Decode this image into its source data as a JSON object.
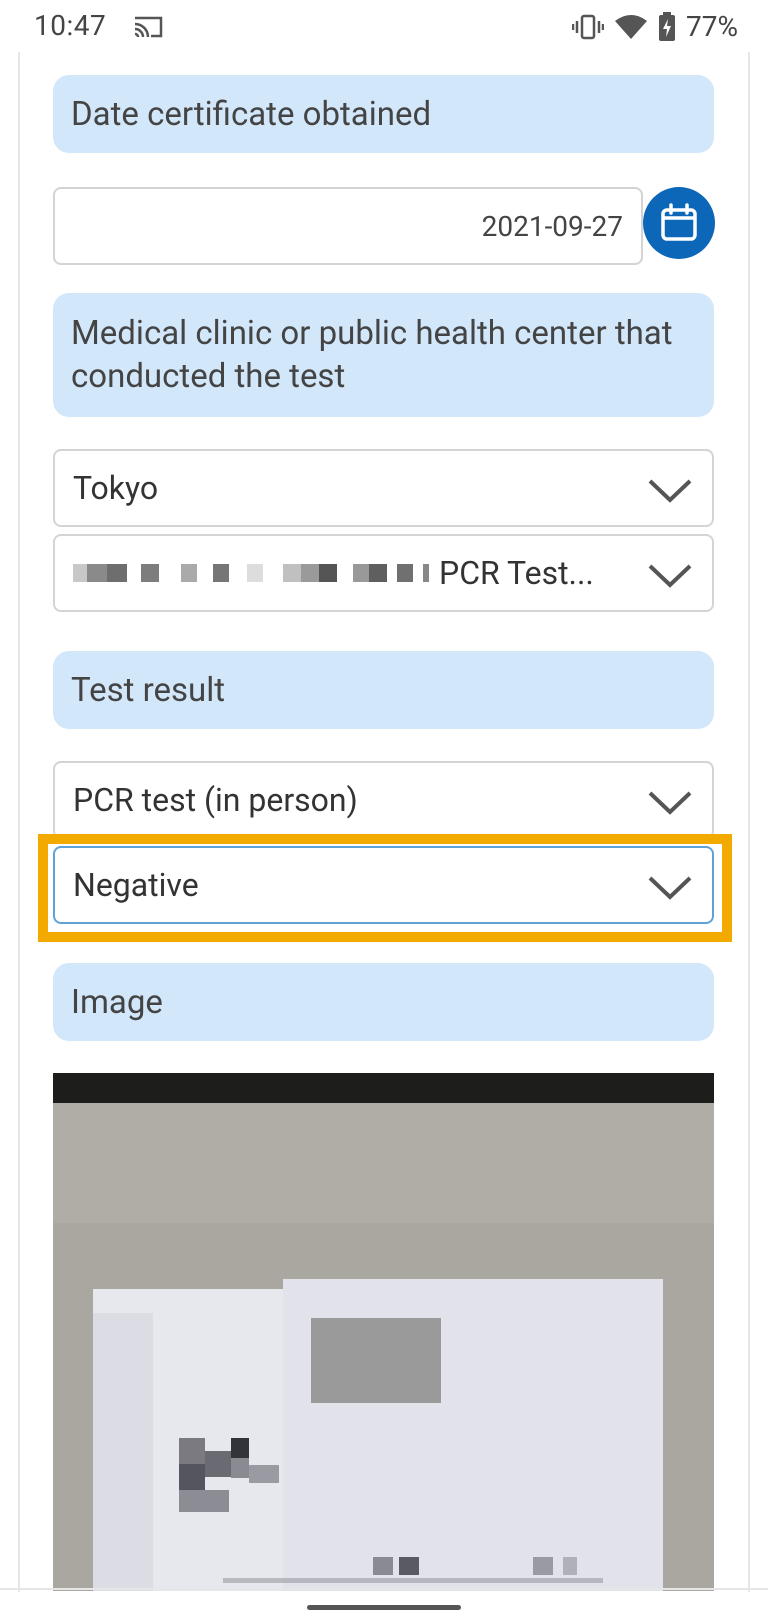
{
  "status_bar": {
    "time": "10:47",
    "battery": "77%"
  },
  "form": {
    "date_label": "Date certificate obtained",
    "date_value": "2021-09-27",
    "clinic_label": "Medical clinic or public health center that conducted the test",
    "prefecture_value": "Tokyo",
    "clinic_value": "PCR Test...",
    "result_label": "Test result",
    "test_type_value": "PCR test (in person)",
    "result_value": "Negative",
    "image_label": "Image"
  },
  "colors": {
    "label_bg": "#d3e7fb",
    "calendar_button": "#0d67b8",
    "highlight": "#f2a900"
  }
}
